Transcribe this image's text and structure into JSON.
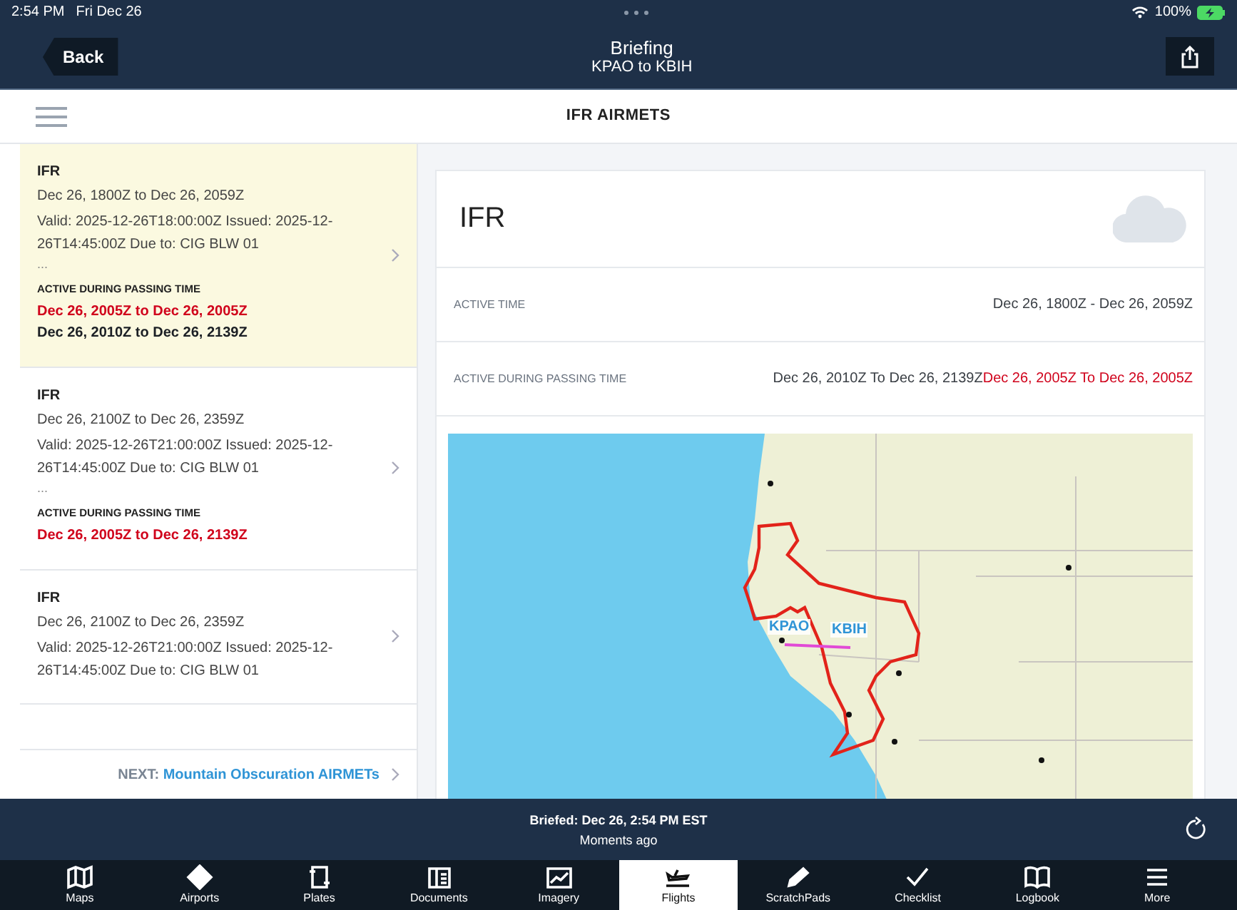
{
  "status_bar": {
    "time": "2:54 PM",
    "date": "Fri Dec 26",
    "battery": "100%"
  },
  "nav": {
    "back": "Back",
    "title": "Briefing",
    "subtitle": "KPAO to KBIH"
  },
  "section_title": "IFR AIRMETS",
  "airmets": [
    {
      "selected": true,
      "title": "IFR",
      "range": "Dec 26, 1800Z to Dec 26, 2059Z",
      "details": "Valid: 2025-12-26T18:00:00Z Issued: 2025-12-26T14:45:00Z Due to: CIG BLW 01",
      "more": "...",
      "active_heading": "ACTIVE DURING PASSING TIME",
      "active_times": [
        {
          "text": "Dec 26, 2005Z to Dec 26, 2005Z",
          "color": "#d0021b"
        },
        {
          "text": "Dec 26, 2010Z to Dec 26, 2139Z",
          "color": "#1b1f24"
        }
      ]
    },
    {
      "selected": false,
      "title": "IFR",
      "range": "Dec 26, 2100Z to Dec 26, 2359Z",
      "details": "Valid: 2025-12-26T21:00:00Z Issued: 2025-12-26T14:45:00Z Due to: CIG BLW 01",
      "more": "...",
      "active_heading": "ACTIVE DURING PASSING TIME",
      "active_times": [
        {
          "text": "Dec 26, 2005Z to Dec 26, 2139Z",
          "color": "#d0021b"
        }
      ]
    },
    {
      "selected": false,
      "title": "IFR",
      "range": "Dec 26, 2100Z to Dec 26, 2359Z",
      "details": "Valid: 2025-12-26T21:00:00Z Issued: 2025-12-26T14:45:00Z Due to: CIG BLW 01"
    }
  ],
  "next": {
    "label": "NEXT:",
    "target": "Mountain Obscuration AIRMETs"
  },
  "detail": {
    "title": "IFR",
    "rows": [
      {
        "label": "ACTIVE TIME",
        "segments": [
          {
            "text": "Dec 26, 1800Z - Dec 26, 2059Z",
            "color": "#3a3f45"
          }
        ]
      },
      {
        "label": "ACTIVE DURING PASSING TIME",
        "segments": [
          {
            "text": "Dec 26, 2010Z To Dec 26, 2139Z",
            "color": "#3a3f45"
          },
          {
            "text": "Dec 26, 2005Z To Dec 26, 2005Z",
            "color": "#d0021b"
          }
        ]
      }
    ],
    "map": {
      "waypoints": [
        "KPAO",
        "KBIH"
      ]
    }
  },
  "briefed": {
    "title": "Briefed: Dec 26, 2:54 PM EST",
    "subtitle": "Moments ago"
  },
  "tabs": [
    {
      "label": "Maps",
      "selected": false
    },
    {
      "label": "Airports",
      "selected": false
    },
    {
      "label": "Plates",
      "selected": false
    },
    {
      "label": "Documents",
      "selected": false
    },
    {
      "label": "Imagery",
      "selected": false
    },
    {
      "label": "Flights",
      "selected": true
    },
    {
      "label": "ScratchPads",
      "selected": false
    },
    {
      "label": "Checklist",
      "selected": false
    },
    {
      "label": "Logbook",
      "selected": false
    },
    {
      "label": "More",
      "selected": false
    }
  ]
}
